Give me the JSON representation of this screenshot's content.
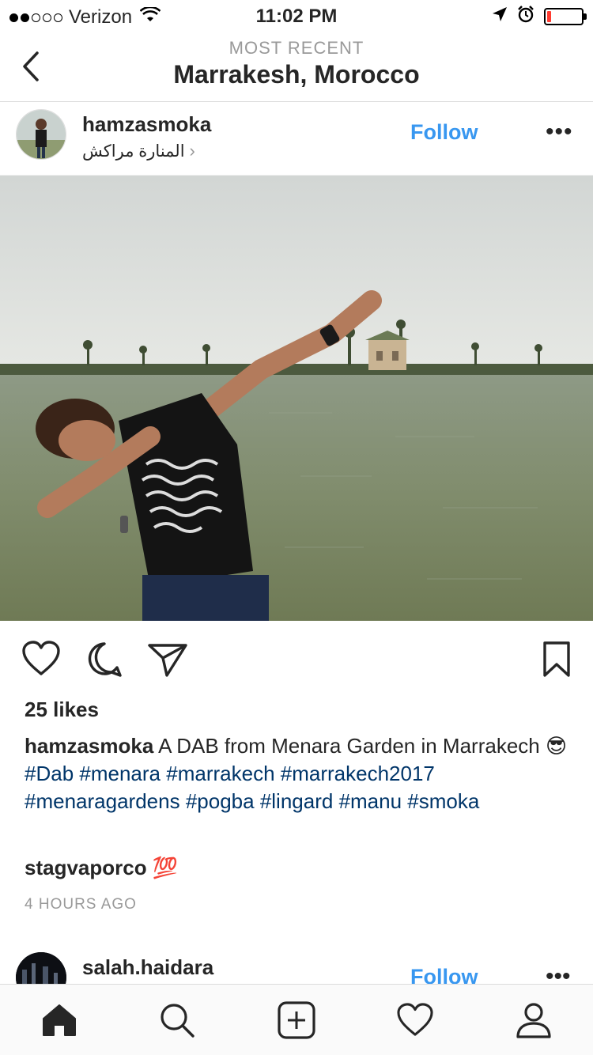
{
  "status_bar": {
    "carrier": "Verizon",
    "time": "11:02 PM",
    "signal_bars": 2,
    "signal_total": 5,
    "battery_level": 0.12,
    "battery_color": "#ff3b30"
  },
  "header": {
    "subtitle": "MOST RECENT",
    "title": "Marrakesh, Morocco"
  },
  "post": {
    "username": "hamzasmoka",
    "location": "المنارة مراكش",
    "follow_label": "Follow",
    "more_label": "•••",
    "likes": "25 likes",
    "caption_user": "hamzasmoka",
    "caption_text": "A DAB from Menara Garden in Marrakech",
    "caption_emoji": "😎",
    "hashtags": [
      "#Dab",
      "#menara",
      "#marrakech",
      "#marrakech2017",
      "#menaragardens",
      "#pogba",
      "#lingard",
      "#manu",
      "#smoka"
    ],
    "comment_user": "stagvaporco",
    "comment_text": "💯",
    "timestamp": "4 HOURS AGO"
  },
  "next_post": {
    "username": "salah.haidara",
    "follow_label": "Follow",
    "more_label": "•••"
  },
  "tabs": [
    {
      "name": "home-icon",
      "active": true
    },
    {
      "name": "search-icon",
      "active": false
    },
    {
      "name": "add-post-icon",
      "active": false
    },
    {
      "name": "activity-heart-icon",
      "active": false
    },
    {
      "name": "profile-icon",
      "active": false
    }
  ],
  "colors": {
    "link_blue": "#3897f0",
    "hashtag": "#003569",
    "muted": "#999999",
    "text": "#262626"
  }
}
